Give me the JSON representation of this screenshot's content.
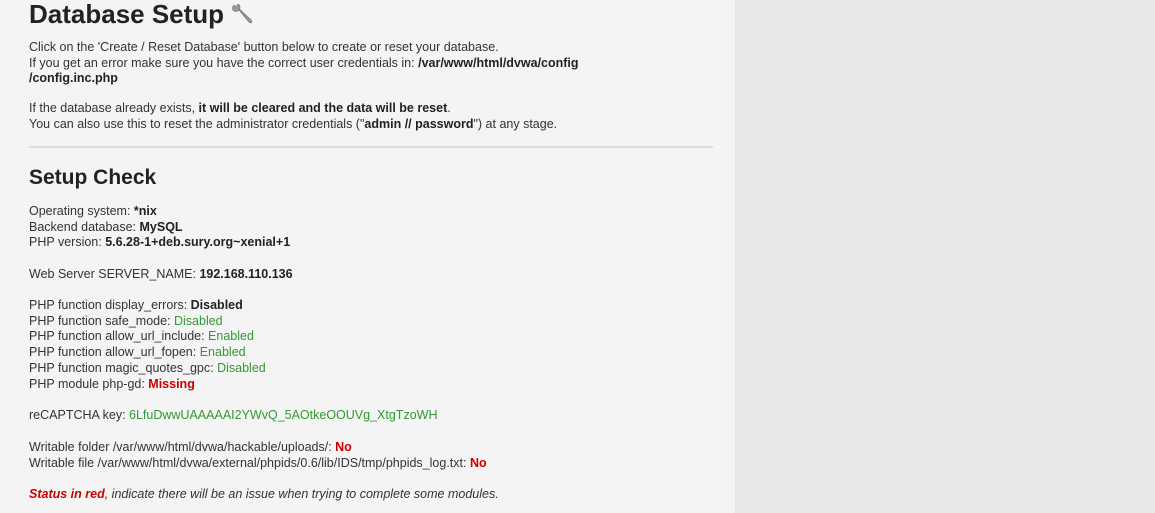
{
  "page": {
    "title": "Database Setup",
    "intro": {
      "line1": "Click on the 'Create / Reset Database' button below to create or reset your database.",
      "line2_prefix": "If you get an error make sure you have the correct user credentials in: ",
      "line2_path_a": "/var/www/html/dvwa/config",
      "line2_path_b": "/config.inc.php",
      "line3_prefix": "If the database already exists, ",
      "line3_bold": "it will be cleared and the data will be reset",
      "line3_suffix": ".",
      "line4_prefix": "You can also use this to reset the administrator credentials (\"",
      "line4_bold": "admin // password",
      "line4_suffix": "\") at any stage."
    }
  },
  "setup_check": {
    "heading": "Setup Check",
    "os_label": "Operating system: ",
    "os_value": "*nix",
    "db_label": "Backend database: ",
    "db_value": "MySQL",
    "php_label": "PHP version: ",
    "php_value": "5.6.28-1+deb.sury.org~xenial+1",
    "server_label": "Web Server SERVER_NAME: ",
    "server_value": "192.168.110.136",
    "functions": [
      {
        "label": "PHP function display_errors: ",
        "value": "Disabled",
        "style": "bold"
      },
      {
        "label": "PHP function safe_mode: ",
        "value": "Disabled",
        "style": "green"
      },
      {
        "label": "PHP function allow_url_include: ",
        "value": "Enabled",
        "style": "green"
      },
      {
        "label": "PHP function allow_url_fopen: ",
        "value": "Enabled",
        "style": "green"
      },
      {
        "label": "PHP function magic_quotes_gpc: ",
        "value": "Disabled",
        "style": "green"
      },
      {
        "label": "PHP module php-gd: ",
        "value": "Missing",
        "style": "red"
      }
    ],
    "recaptcha_label": "reCAPTCHA key: ",
    "recaptcha_value": "6LfuDwwUAAAAAI2YWvQ_5AOtkeOOUVg_XtgTzoWH",
    "writable_folder_label": "Writable folder /var/www/html/dvwa/hackable/uploads/: ",
    "writable_folder_value": "No",
    "writable_file_label": "Writable file /var/www/html/dvwa/external/phpids/0.6/lib/IDS/tmp/phpids_log.txt: ",
    "writable_file_value": "No",
    "status_red": "Status in red",
    "status_note": ", indicate there will be an issue when trying to complete some modules."
  },
  "colors": {
    "ok": "#339933",
    "error": "#cc0000"
  },
  "icons": {
    "title_icon": "wrench-icon"
  }
}
